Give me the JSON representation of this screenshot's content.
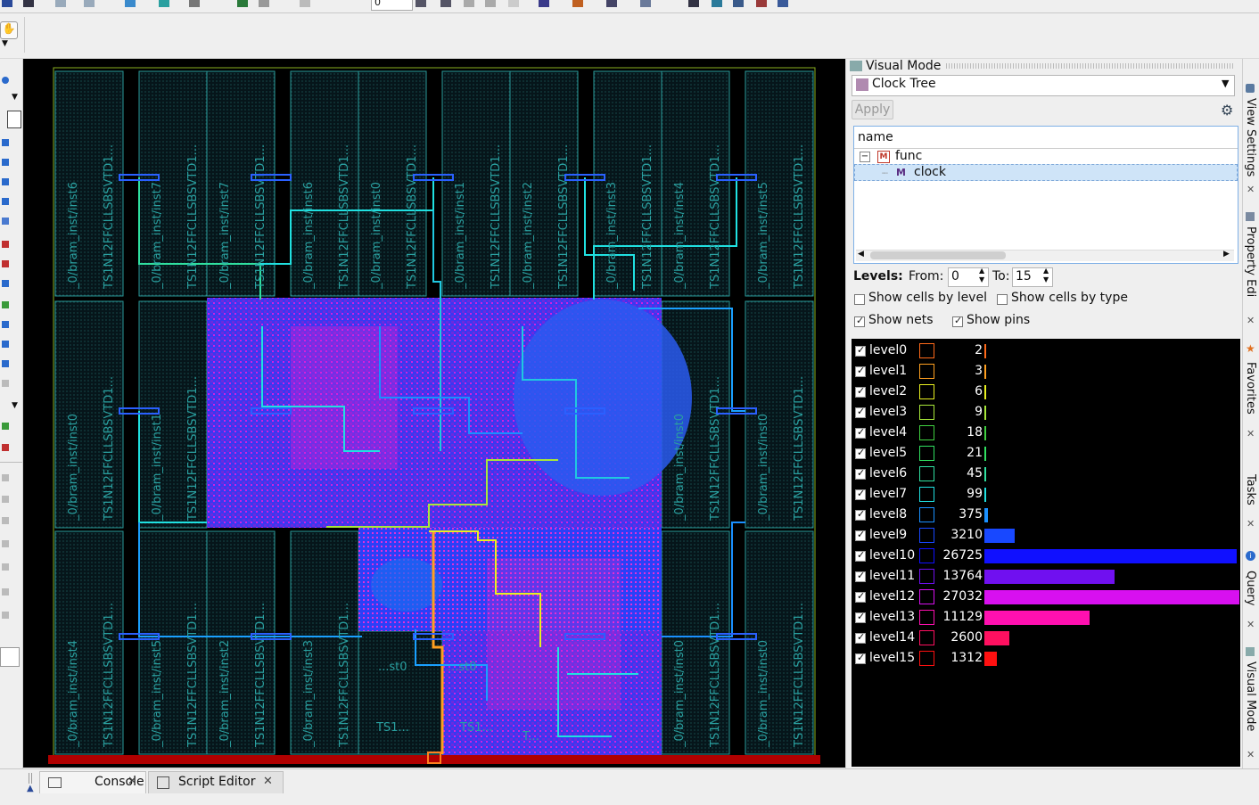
{
  "toolbar": {
    "zoom_value": "0"
  },
  "layout": {
    "top_instances": [
      {
        "name": "_0/bram_inst/inst6",
        "type": "TS1N12FFCLLSBSVTD1..."
      },
      {
        "name": "_0/bram_inst/inst7",
        "type": "TS1N12FFCLLSBSVTD1..."
      },
      {
        "name": "_0/bram_inst/inst7",
        "type": "TS1N12FFCLLSBSVTD1..."
      },
      {
        "name": "_0/bram_inst/inst6",
        "type": "TS1N12FFCLLSBSVTD1..."
      },
      {
        "name": "_0/bram_inst/inst0",
        "type": "TS1N12FFCLLSBSVTD1..."
      },
      {
        "name": "_0/bram_inst/inst1",
        "type": "TS1N12FFCLLSBSVTD1..."
      },
      {
        "name": "_0/bram_inst/inst2",
        "type": "TS1N12FFCLLSBSVTD1..."
      },
      {
        "name": "_0/bram_inst/inst3",
        "type": "TS1N12FFCLLSBSVTD1..."
      },
      {
        "name": "_0/bram_inst/inst4",
        "type": "TS1N12FFCLLSBSVTD1..."
      },
      {
        "name": "_0/bram_inst/inst5",
        "type": "TS1N12FFCLLSBSVTD1..."
      }
    ],
    "mid_instances": [
      {
        "name": "_0/bram_inst/inst0",
        "type": "TS1N12FFCLLSBSVTD1..."
      },
      {
        "name": "_0/bram_inst/inst1",
        "type": "TS1N12FFCLLSBSVTD1..."
      },
      {
        "name": "_0/bram_inst/inst0",
        "type": "TS1N12FFCLLSBSVTD1..."
      },
      {
        "name": "_0/bram_inst/inst0",
        "type": "TS1N12FFCLLSBSVTD1..."
      }
    ],
    "bottom_instances": [
      {
        "name": "_0/bram_inst/inst4",
        "type": "TS1N12FFCLLSBSVTD1..."
      },
      {
        "name": "_0/bram_inst/inst5",
        "type": "TS1N12FFCLLSBSVTD1..."
      },
      {
        "name": "_0/bram_inst/inst2",
        "type": "TS1N12FFCLLSBSVTD1..."
      },
      {
        "name": "_0/bram_inst/inst3",
        "type": "TS1N12FFCLLSBSVTD1..."
      },
      {
        "name": "_0/bram_inst/inst0",
        "type": "TS1N12FFCLLSBSVTD1..."
      },
      {
        "name": "_0/bram_inst/inst0",
        "type": "TS1N12FFCLLSBSVTD1..."
      }
    ],
    "partial_labels": [
      "...st0",
      "...st0",
      "TS1...",
      "TS1...",
      "T..."
    ]
  },
  "visual_mode": {
    "title": "Visual Mode",
    "mode_selected": "Clock Tree",
    "apply_label": "Apply",
    "tree_header": "name",
    "tree_items": [
      {
        "label": "func",
        "badge": "M",
        "badge_color": "#c0392b"
      },
      {
        "label": "clock",
        "badge": "M",
        "badge_color": "#5a2d82"
      }
    ],
    "levels_label": "Levels:",
    "from_label": "From:",
    "from_value": "0",
    "to_label": "To:",
    "to_value": "15",
    "options": [
      {
        "label": "Show cells by level",
        "checked": false
      },
      {
        "label": "Show cells by type",
        "checked": false
      },
      {
        "label": "Show nets",
        "checked": true
      },
      {
        "label": "Show pins",
        "checked": true
      }
    ],
    "levels": [
      {
        "name": "level0",
        "count": "2",
        "value": 2,
        "color": "#ff6a1a"
      },
      {
        "name": "level1",
        "count": "3",
        "value": 3,
        "color": "#ffa020"
      },
      {
        "name": "level2",
        "count": "6",
        "value": 6,
        "color": "#e8f020"
      },
      {
        "name": "level3",
        "count": "9",
        "value": 9,
        "color": "#a8e83a"
      },
      {
        "name": "level4",
        "count": "18",
        "value": 18,
        "color": "#40d040"
      },
      {
        "name": "level5",
        "count": "21",
        "value": 21,
        "color": "#30e060"
      },
      {
        "name": "level6",
        "count": "45",
        "value": 45,
        "color": "#30e0a0"
      },
      {
        "name": "level7",
        "count": "99",
        "value": 99,
        "color": "#20e0e0"
      },
      {
        "name": "level8",
        "count": "375",
        "value": 375,
        "color": "#1a90ff"
      },
      {
        "name": "level9",
        "count": "3210",
        "value": 3210,
        "color": "#1848ff"
      },
      {
        "name": "level10",
        "count": "26725",
        "value": 26725,
        "color": "#1010ff"
      },
      {
        "name": "level11",
        "count": "13764",
        "value": 13764,
        "color": "#7010f0"
      },
      {
        "name": "level12",
        "count": "27032",
        "value": 27032,
        "color": "#d810f0"
      },
      {
        "name": "level13",
        "count": "11129",
        "value": 11129,
        "color": "#ff10b0"
      },
      {
        "name": "level14",
        "count": "2600",
        "value": 2600,
        "color": "#ff1060"
      },
      {
        "name": "level15",
        "count": "1312",
        "value": 1312,
        "color": "#ff1010"
      }
    ]
  },
  "right_dock": {
    "tabs": [
      "View Settings",
      "Property Edi",
      "Favorites",
      "Tasks",
      "Query",
      "Visual Mode"
    ]
  },
  "bottom_tabs": [
    {
      "label": "Console"
    },
    {
      "label": "Script Editor"
    }
  ]
}
